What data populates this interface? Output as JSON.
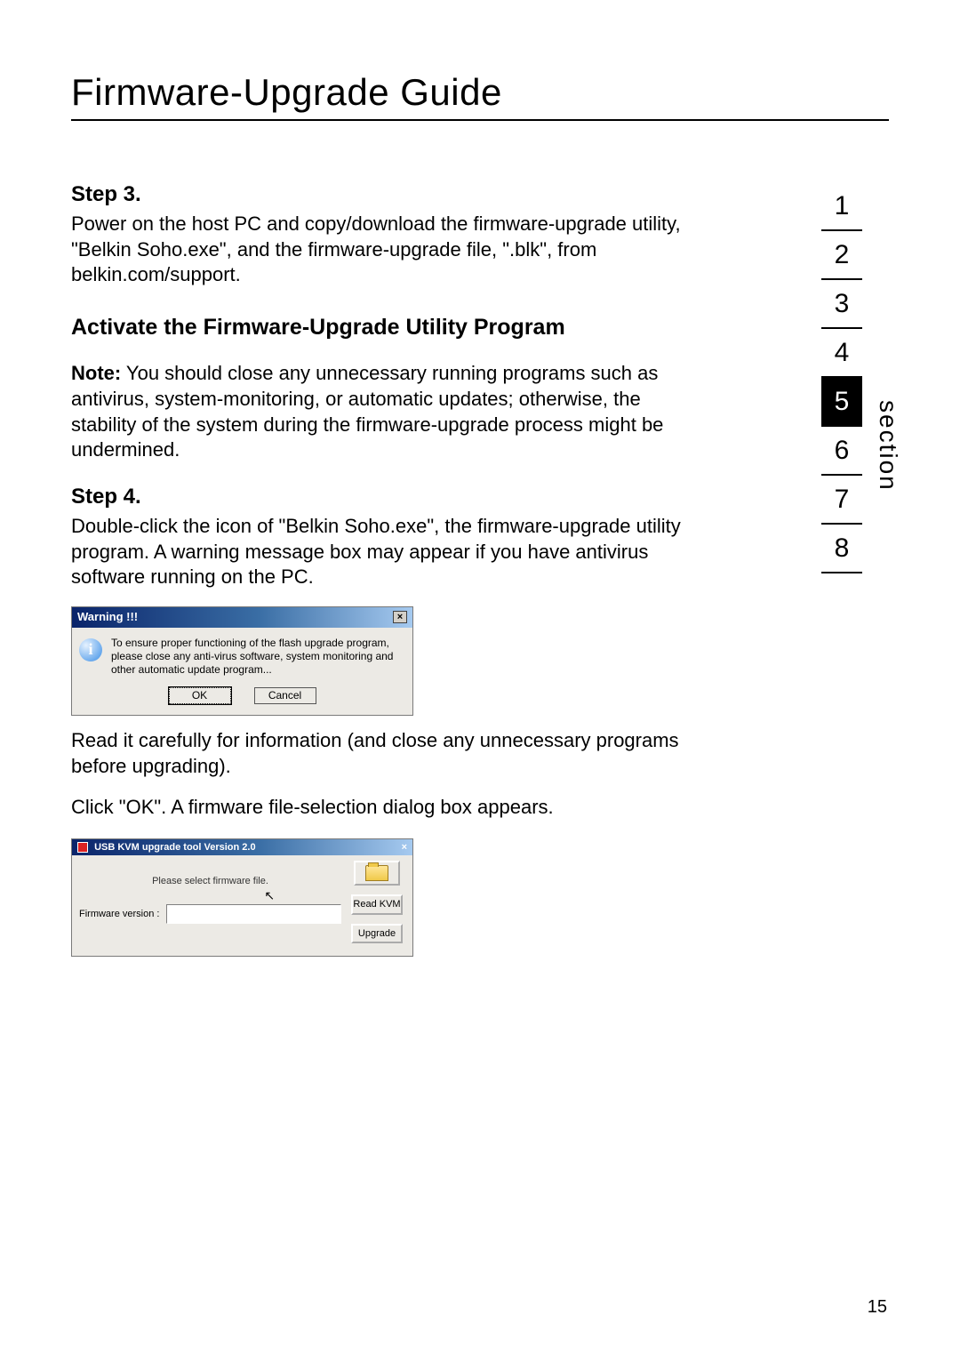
{
  "page_title": "Firmware-Upgrade Guide",
  "page_number": "15",
  "nav": {
    "label": "section",
    "items": [
      "1",
      "2",
      "3",
      "4",
      "5",
      "6",
      "7",
      "8"
    ],
    "active_index": 4
  },
  "step3": {
    "heading": "Step 3.",
    "text": "Power on the host PC and copy/download the firmware-upgrade utility, \"Belkin Soho.exe\", and the firmware-upgrade file, \".blk\", from belkin.com/support."
  },
  "activate_heading": "Activate the Firmware-Upgrade Utility Program",
  "note": {
    "label": "Note:",
    "text": " You should close any unnecessary running programs such as antivirus, system-monitoring, or automatic updates; otherwise, the stability of the system during the firmware-upgrade process might be undermined."
  },
  "step4": {
    "heading": "Step 4.",
    "text": "Double-click the icon of \"Belkin Soho.exe\", the firmware-upgrade utility program. A warning message box may appear if you have antivirus software running on the PC."
  },
  "warning_dialog": {
    "title": "Warning !!!",
    "message": "To ensure proper functioning of the flash upgrade program, please close any anti-virus software, system monitoring and other automatic update program...",
    "ok": "OK",
    "cancel": "Cancel"
  },
  "after_warning": "Read it carefully for information (and close any unnecessary programs before upgrading).",
  "click_ok": "Click \"OK\". A firmware file-selection dialog box appears.",
  "kvm_dialog": {
    "title": "USB KVM upgrade tool Version 2.0",
    "prompt": "Please select firmware file.",
    "fver_label": "Firmware version :",
    "read_btn": "Read KVM",
    "upgrade_btn": "Upgrade"
  }
}
